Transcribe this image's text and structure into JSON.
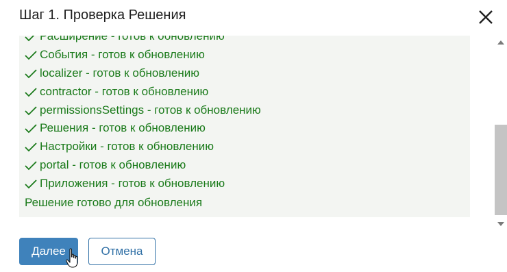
{
  "dialog": {
    "title": "Шаг 1. Проверка Решения",
    "close_icon": "close-icon"
  },
  "log": {
    "items": [
      {
        "label": "Расширение - готов к обновлению"
      },
      {
        "label": "События - готов к обновлению"
      },
      {
        "label": "localizer - готов к обновлению"
      },
      {
        "label": "contractor - готов к обновлению"
      },
      {
        "label": "permissionsSettings - готов к обновлению"
      },
      {
        "label": "Решения - готов к обновлению"
      },
      {
        "label": "Настройки - готов к обновлению"
      },
      {
        "label": "portal - готов к обновлению"
      },
      {
        "label": "Приложения - готов к обновлению"
      }
    ],
    "summary": "Решение готово для обновления",
    "item_icon": "check-icon"
  },
  "buttons": {
    "next_label": "Далее",
    "cancel_label": "Отмена"
  },
  "colors": {
    "success_text": "#1a7a1a",
    "primary": "#3f82bb",
    "log_background": "#f3f5f2"
  }
}
